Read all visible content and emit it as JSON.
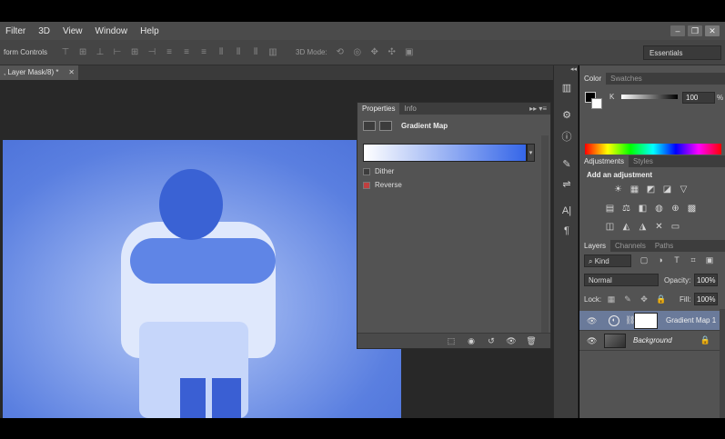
{
  "menu": [
    "Filter",
    "3D",
    "View",
    "Window",
    "Help"
  ],
  "window_controls": [
    "–",
    "❐",
    "✕"
  ],
  "options_bar": {
    "label": "form Controls",
    "mode_label": "3D Mode:",
    "workspace": "Essentials"
  },
  "document_tab": {
    "title": ", Layer Mask/8) *",
    "close": "✕"
  },
  "properties_panel": {
    "tabs": [
      "Properties",
      "Info"
    ],
    "menu_glyph": "▸▸ ▾≡",
    "title": "Gradient Map",
    "gradient": {
      "start_color": "#ffffff",
      "end_color": "#3566e8",
      "dropdown_glyph": "▾"
    },
    "dither": {
      "label": "Dither",
      "checked": false
    },
    "reverse": {
      "label": "Reverse",
      "checked": true
    },
    "footer_icons": [
      "clip-to-layer-icon",
      "view-previous-icon",
      "reset-icon",
      "visibility-icon",
      "trash-icon"
    ],
    "footer_glyphs": [
      "⬚",
      "◉",
      "↺",
      "👁",
      "🗑"
    ]
  },
  "toolstrip": {
    "collapse_glyph": "◂◂",
    "icons": [
      "histogram-icon",
      "adjustments-icon",
      "info-icon",
      "brush-icon",
      "sliders-icon",
      "character-icon",
      "paragraph-icon"
    ],
    "glyphs": [
      "▥",
      "⚙",
      "ⓘ",
      "✎",
      "⇌",
      "A|",
      "¶"
    ]
  },
  "color_panel": {
    "tabs": [
      "Color",
      "Swatches"
    ],
    "channel_label": "K",
    "value": "100",
    "unit": "%"
  },
  "adjustments_panel": {
    "tabs": [
      "Adjustments",
      "Styles"
    ],
    "heading": "Add an adjustment",
    "row1": [
      "☀",
      "▦",
      "◩",
      "◪",
      "▽"
    ],
    "row2": [
      "▤",
      "⚖",
      "◧",
      "◍",
      "⊕",
      "▩"
    ],
    "row3": [
      "◫",
      "◭",
      "◮",
      "✕",
      "▭"
    ]
  },
  "layers_panel": {
    "tabs": [
      "Layers",
      "Channels",
      "Paths"
    ],
    "filter_kind": "⌕ Kind",
    "filter_icons": [
      "▢",
      "◑",
      "T",
      "⌗",
      "▣"
    ],
    "blend_mode": "Normal",
    "opacity_label": "Opacity:",
    "opacity": "100%",
    "lock_label": "Lock:",
    "lock_icons": [
      "▦",
      "✎",
      "✥",
      "🔒"
    ],
    "fill_label": "Fill:",
    "fill": "100%",
    "layers": [
      {
        "name": "Gradient Map 1",
        "selected": true
      },
      {
        "name": "Background",
        "selected": false
      }
    ],
    "eye_glyph": "👁",
    "chain_glyph": "⛓",
    "lock_glyph": "🔒"
  }
}
